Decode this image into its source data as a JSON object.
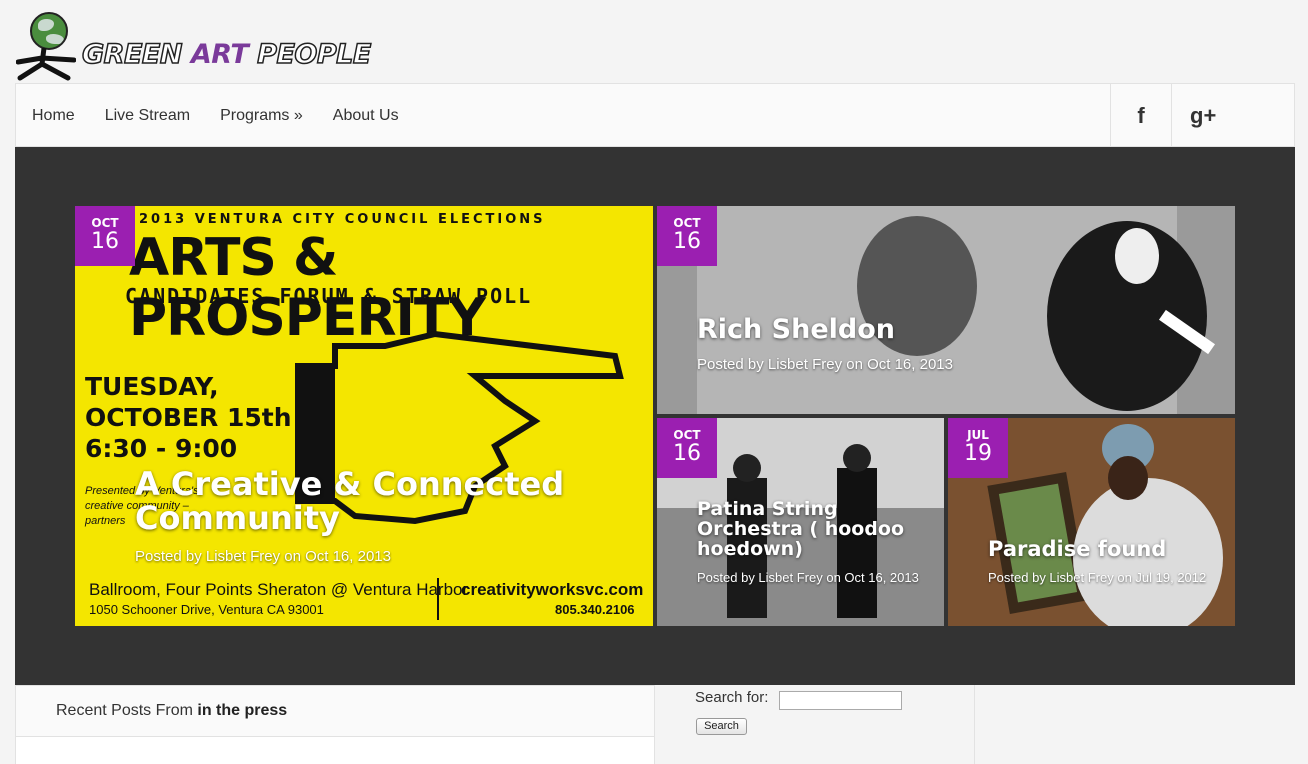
{
  "logo": {
    "text_pre": "GREEN ",
    "text_art": "ART",
    "text_post": " PEOPLE"
  },
  "nav": {
    "items": [
      {
        "label": "Home"
      },
      {
        "label": "Live Stream"
      },
      {
        "label": "Programs »"
      },
      {
        "label": "About Us"
      }
    ],
    "social": {
      "facebook": "f",
      "googleplus": "g+"
    }
  },
  "slides": [
    {
      "date_month": "OCT",
      "date_day": "16",
      "title": "A Creative & Connected Community",
      "meta": "Posted by Lisbet Frey on Oct 16, 2013",
      "poster": {
        "head": "2013 VENTURA CITY COUNCIL ELECTIONS",
        "big": "ARTS & PROSPERITY",
        "sub": "CANDIDATES FORUM & STRAW POLL",
        "when1": "TUESDAY,",
        "when2": "OCTOBER 15th",
        "when3": "6:30 - 9:00",
        "pre1": "Presented by Ventura's",
        "pre2": "creative community –",
        "pre3": "partners",
        "venue": "Ballroom, Four Points Sheraton @ Ventura Harbor",
        "addr": "1050 Schooner Drive, Ventura CA 93001",
        "url": "creativityworksvc.com",
        "phone": "805.340.2106"
      }
    },
    {
      "date_month": "OCT",
      "date_day": "16",
      "title": "Rich Sheldon",
      "meta": "Posted by Lisbet Frey on Oct 16, 2013"
    },
    {
      "date_month": "OCT",
      "date_day": "16",
      "title": "Patina String Orchestra ( hoodoo hoedown)",
      "meta": "Posted by Lisbet Frey on Oct 16, 2013"
    },
    {
      "date_month": "JUL",
      "date_day": "19",
      "title": "Paradise found",
      "meta": "Posted by Lisbet Frey on Jul 19, 2012"
    }
  ],
  "recent": {
    "prefix": "Recent Posts From ",
    "category": "in the press"
  },
  "search": {
    "label": "Search for:",
    "value": "",
    "button": "Search"
  }
}
